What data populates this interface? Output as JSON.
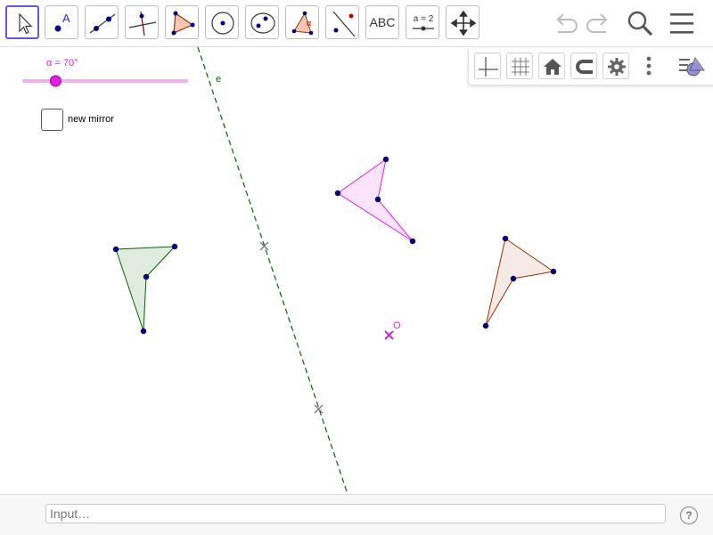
{
  "toolbar": {
    "tools": [
      {
        "name": "move-tool",
        "icon": "arrow-pointer-icon"
      },
      {
        "name": "point-tool",
        "icon": "point-icon",
        "label": "A"
      },
      {
        "name": "line-tool",
        "icon": "line-icon"
      },
      {
        "name": "perpendicular-line-tool",
        "icon": "perpendicular-icon"
      },
      {
        "name": "polygon-tool",
        "icon": "polygon-icon"
      },
      {
        "name": "circle-tool",
        "icon": "circle-icon"
      },
      {
        "name": "ellipse-tool",
        "icon": "ellipse-icon"
      },
      {
        "name": "angle-tool",
        "icon": "angle-icon",
        "label": "α"
      },
      {
        "name": "reflect-tool",
        "icon": "reflect-icon"
      },
      {
        "name": "text-tool",
        "icon": "text-icon",
        "label": "ABC"
      },
      {
        "name": "slider-tool",
        "icon": "slider-icon",
        "label": "a = 2"
      },
      {
        "name": "move-graphics-tool",
        "icon": "move-arrows-icon"
      }
    ],
    "undo": "undo-icon",
    "redo": "redo-icon",
    "search": "search-icon",
    "menu": "hamburger-menu-icon"
  },
  "style_bar": {
    "buttons": [
      "axes-icon",
      "grid-icon",
      "home-icon",
      "magnet-icon",
      "gear-icon",
      "more-vertical-icon",
      "toggle-stylebar-icon"
    ]
  },
  "graphics": {
    "slider": {
      "label": "α = 70°",
      "value_deg": 70,
      "min_deg": 0,
      "max_deg": 360,
      "color": "#e020e0"
    },
    "checkbox": {
      "label": "new mirror",
      "checked": false
    },
    "mirror_line": {
      "label": "e",
      "color": "#006400"
    },
    "rotation_center_label": "O",
    "colors": {
      "green_polygon": "#006400",
      "pink_polygon": "#e020e0",
      "brown_polygon": "#993300",
      "points": "#00008b",
      "marker": "#808080"
    }
  },
  "input_bar": {
    "placeholder": "Input…",
    "help": "?"
  }
}
